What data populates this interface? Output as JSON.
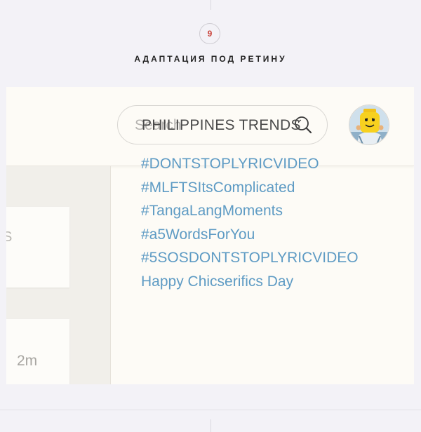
{
  "step": {
    "number": "9"
  },
  "section": {
    "title": "АДАПТАЦИЯ ПОД РЕТИНУ"
  },
  "header": {
    "search": {
      "placeholder": "Search",
      "value": ""
    },
    "avatar": {
      "icon": "avatar-icon"
    }
  },
  "feed": {
    "cards": [
      {
        "partial_text": "S"
      },
      {
        "time": "2m"
      }
    ]
  },
  "trends": {
    "title": "PHILIPPINES TRENDS",
    "items": [
      "#DONTSTOPLYRICVIDEO",
      "#MLFTSItsComplicated",
      "#TangaLangMoments",
      "#a5WordsForYou",
      "#5SOSDONTSTOPLYRICVIDEO",
      "Happy Chicserifics Day"
    ]
  },
  "colors": {
    "background": "#f3f2f7",
    "panel": "#fdfbf6",
    "link": "#5e9bc4",
    "step_number": "#c9423a"
  }
}
